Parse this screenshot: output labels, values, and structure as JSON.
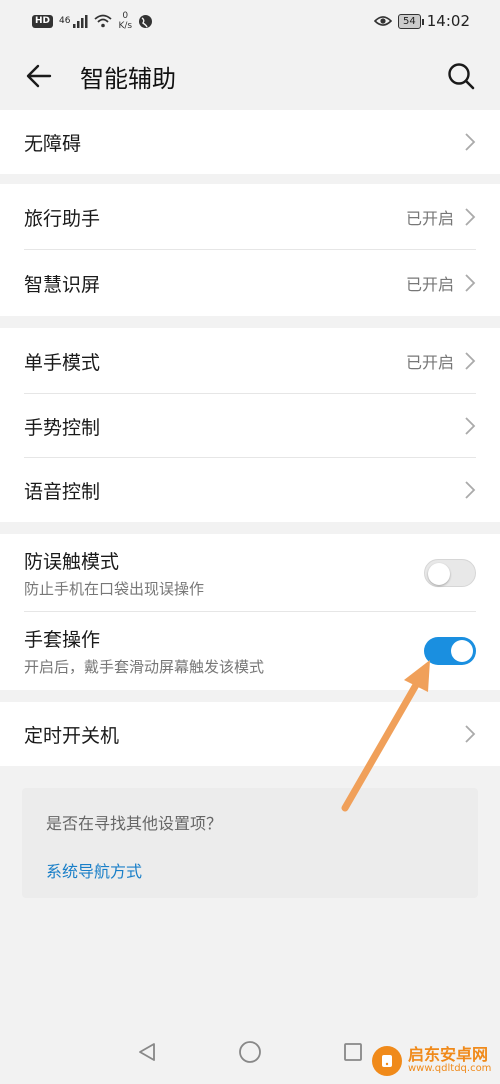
{
  "status_bar": {
    "hd": "HD",
    "signal": "46",
    "net_speed_value": "0",
    "net_speed_unit": "K/s",
    "battery": "54",
    "time": "14:02"
  },
  "header": {
    "title": "智能辅助"
  },
  "groups": {
    "g1": [
      {
        "label": "无障碍",
        "status": ""
      }
    ],
    "g2": [
      {
        "label": "旅行助手",
        "status": "已开启"
      },
      {
        "label": "智慧识屏",
        "status": "已开启"
      }
    ],
    "g3": [
      {
        "label": "单手模式",
        "status": "已开启"
      },
      {
        "label": "手势控制",
        "status": ""
      },
      {
        "label": "语音控制",
        "status": ""
      }
    ],
    "g4": [
      {
        "label": "防误触模式",
        "sub": "防止手机在口袋出现误操作",
        "toggle": "off"
      },
      {
        "label": "手套操作",
        "sub": "开启后，戴手套滑动屏幕触发该模式",
        "toggle": "on"
      }
    ],
    "g5": [
      {
        "label": "定时开关机",
        "status": ""
      }
    ]
  },
  "suggest": {
    "question": "是否在寻找其他设置项？",
    "link": "系统导航方式"
  },
  "watermark": {
    "name": "启东安卓网",
    "url": "www.qdltdq.com"
  },
  "colors": {
    "accent": "#1a8fe0",
    "link": "#1a7fc8",
    "arrow": "#f0a05a",
    "watermark": "#f08a1a"
  }
}
